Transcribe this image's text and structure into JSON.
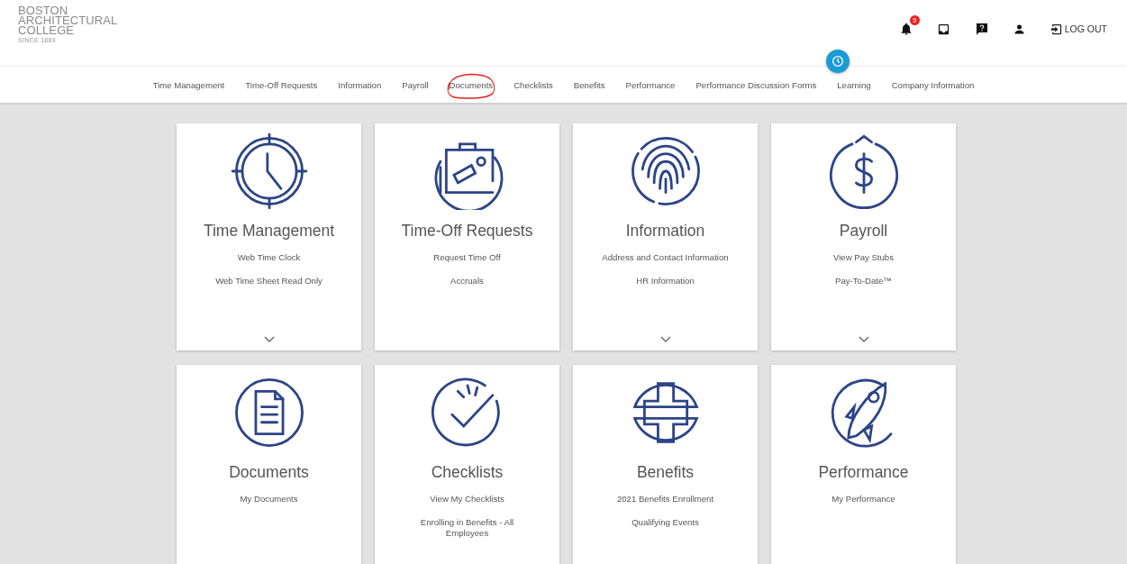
{
  "logo": {
    "lines": [
      "BOSTON",
      "ARCHITECTURAL",
      "COLLEGE"
    ],
    "tagline": "SINCE 1889"
  },
  "header": {
    "notification_count": "5",
    "logout_label": "LOG OUT"
  },
  "nav": [
    {
      "label": "Time Management",
      "circled": false
    },
    {
      "label": "Time-Off Requests",
      "circled": false
    },
    {
      "label": "Information",
      "circled": false
    },
    {
      "label": "Payroll",
      "circled": false
    },
    {
      "label": "Documents",
      "circled": true
    },
    {
      "label": "Checklists",
      "circled": false
    },
    {
      "label": "Benefits",
      "circled": false
    },
    {
      "label": "Performance",
      "circled": false
    },
    {
      "label": "Performance Discussion Forms",
      "circled": false
    },
    {
      "label": "Learning",
      "circled": false
    },
    {
      "label": "Company Information",
      "circled": false
    }
  ],
  "cards": [
    {
      "title": "Time Management",
      "links": [
        "Web Time Clock",
        "Web Time Sheet Read Only"
      ],
      "expandable": true
    },
    {
      "title": "Time-Off Requests",
      "links": [
        "Request Time Off",
        "Accruals"
      ],
      "expandable": false
    },
    {
      "title": "Information",
      "links": [
        "Address and Contact Information",
        "HR Information"
      ],
      "expandable": true
    },
    {
      "title": "Payroll",
      "links": [
        "View Pay Stubs",
        "Pay-To-Date™"
      ],
      "expandable": true
    },
    {
      "title": "Documents",
      "links": [
        "My Documents"
      ],
      "expandable": false
    },
    {
      "title": "Checklists",
      "links": [
        "View My Checklists",
        "Enrolling in Benefits - All Employees"
      ],
      "expandable": false
    },
    {
      "title": "Benefits",
      "links": [
        "2021 Benefits Enrollment",
        "Qualifying Events"
      ],
      "expandable": false
    },
    {
      "title": "Performance",
      "links": [
        "My Performance"
      ],
      "expandable": false
    }
  ]
}
